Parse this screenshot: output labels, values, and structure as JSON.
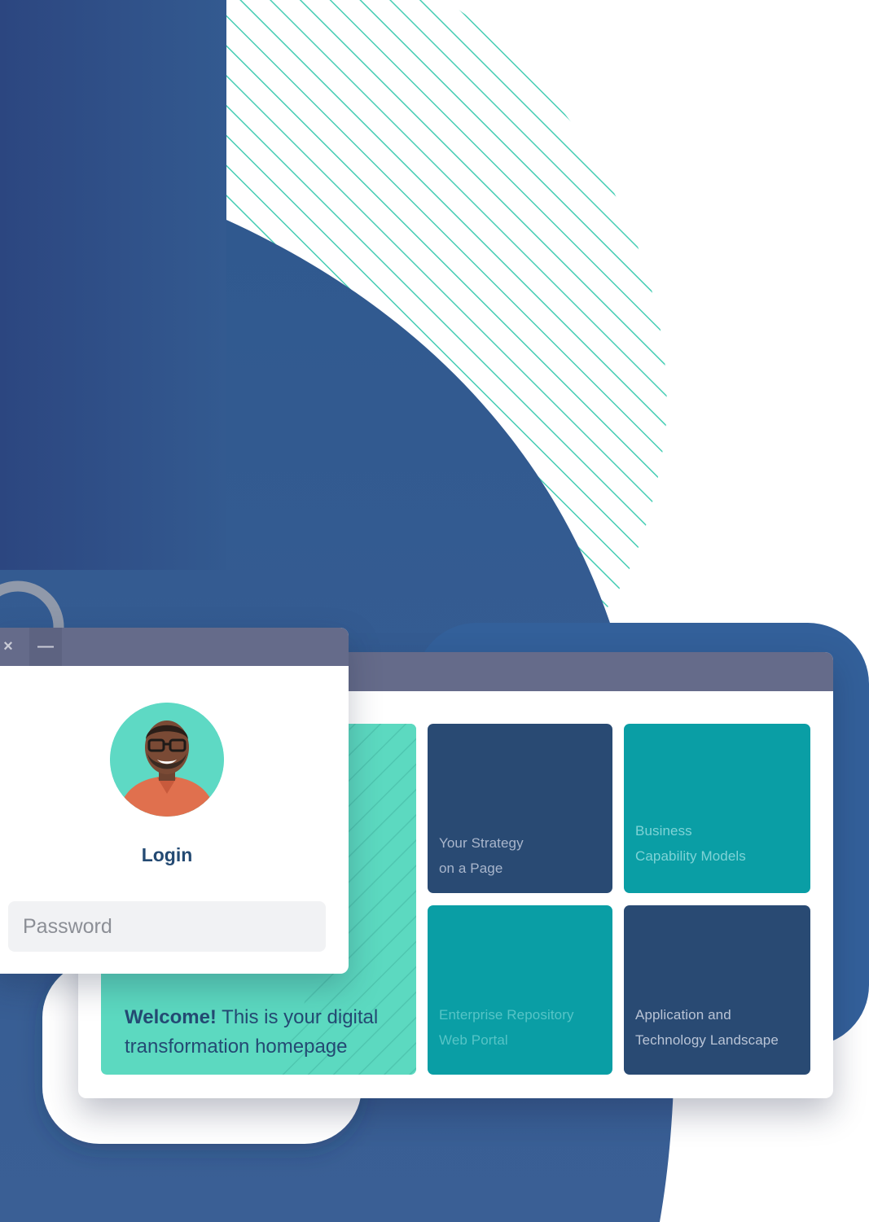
{
  "login_window": {
    "close_glyph": "×",
    "minimize_glyph": "—",
    "title": "Login",
    "password_placeholder": "Password",
    "avatar_icon": "user-avatar-photo"
  },
  "app_window": {
    "welcome": {
      "bold": "Welcome!",
      "text_line1_rest": " This is your digital",
      "text_line2": "transformation homepage"
    },
    "tiles": [
      {
        "line1": "Your Strategy",
        "line2": "on a Page",
        "color": "#294a73"
      },
      {
        "line1": "Business",
        "line2": "Capability Models",
        "color": "#0a9ea5"
      },
      {
        "line1": "Enterprise Repository",
        "line2": "Web Portal",
        "color": "#0a9ea5"
      },
      {
        "line1": "Application and",
        "line2": "Technology Landscape",
        "color": "#294a73"
      }
    ]
  },
  "colors": {
    "navy": "#2e4a80",
    "blue": "#325f95",
    "mint": "#5cd9c0",
    "titlebar": "#656b8a"
  }
}
